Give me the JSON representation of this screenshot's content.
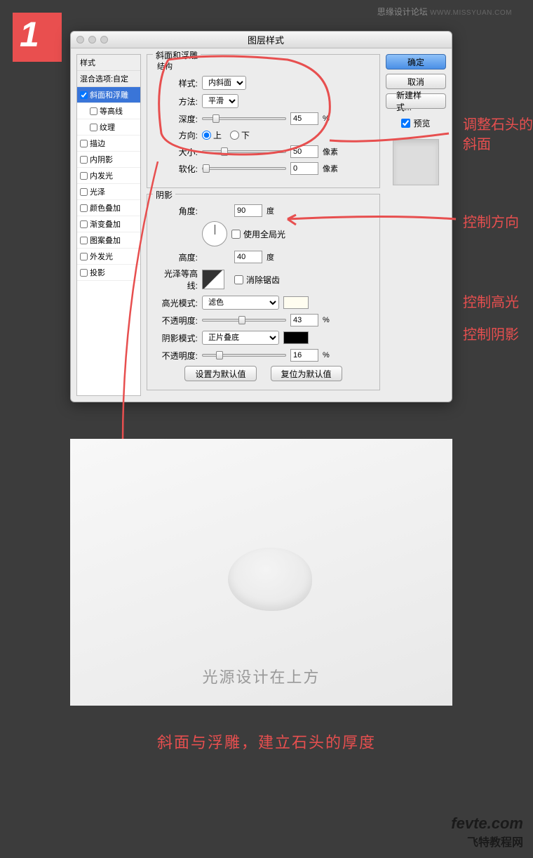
{
  "step_number": "1",
  "watermark": {
    "name": "思缘设计论坛",
    "url": "WWW.MISSYUAN.COM"
  },
  "dialog_title": "图层样式",
  "styles_list": {
    "header": "样式",
    "blend_options": "混合选项:自定",
    "items": [
      {
        "label": "斜面和浮雕",
        "checked": true,
        "selected": true
      },
      {
        "label": "等高线",
        "checked": false,
        "sub": true
      },
      {
        "label": "纹理",
        "checked": false,
        "sub": true
      },
      {
        "label": "描边",
        "checked": false
      },
      {
        "label": "内阴影",
        "checked": false
      },
      {
        "label": "内发光",
        "checked": false
      },
      {
        "label": "光泽",
        "checked": false
      },
      {
        "label": "颜色叠加",
        "checked": false
      },
      {
        "label": "渐变叠加",
        "checked": false
      },
      {
        "label": "图案叠加",
        "checked": false
      },
      {
        "label": "外发光",
        "checked": false
      },
      {
        "label": "投影",
        "checked": false
      }
    ]
  },
  "bevel": {
    "legend": "斜面和浮雕",
    "structure_label": "结构",
    "style_label": "样式:",
    "style_value": "内斜面",
    "technique_label": "方法:",
    "technique_value": "平滑",
    "depth_label": "深度:",
    "depth_value": "45",
    "depth_unit": "%",
    "direction_label": "方向:",
    "direction_up": "上",
    "direction_down": "下",
    "size_label": "大小:",
    "size_value": "50",
    "size_unit": "像素",
    "soften_label": "软化:",
    "soften_value": "0",
    "soften_unit": "像素"
  },
  "shading": {
    "legend": "阴影",
    "angle_label": "角度:",
    "angle_value": "90",
    "angle_unit": "度",
    "global_light": "使用全局光",
    "altitude_label": "高度:",
    "altitude_value": "40",
    "altitude_unit": "度",
    "gloss_contour_label": "光泽等高线:",
    "antialias": "消除锯齿",
    "highlight_mode_label": "高光模式:",
    "highlight_mode_value": "滤色",
    "highlight_opacity_label": "不透明度:",
    "highlight_opacity_value": "43",
    "highlight_opacity_unit": "%",
    "shadow_mode_label": "阴影模式:",
    "shadow_mode_value": "正片叠底",
    "shadow_opacity_label": "不透明度:",
    "shadow_opacity_value": "16",
    "shadow_opacity_unit": "%"
  },
  "buttons": {
    "ok": "确定",
    "cancel": "取消",
    "new_style": "新建样式...",
    "preview": "预览",
    "make_default": "设置为默认值",
    "reset_default": "复位为默认值"
  },
  "annotations": {
    "a1": "调整石头的斜面",
    "a2": "控制方向",
    "a3": "控制高光",
    "a4": "控制阴影"
  },
  "canvas_text": "光源设计在上方",
  "caption": "斜面与浮雕，建立石头的厚度",
  "footer": {
    "l1": "fevte.com",
    "l2": "飞特教程网"
  }
}
